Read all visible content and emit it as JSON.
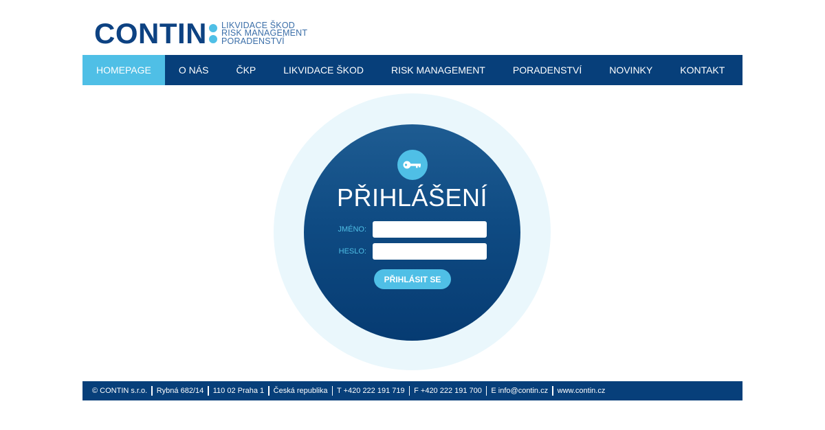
{
  "logo": {
    "word": "CONTIN",
    "tagline": [
      "LIKVIDACE ŠKOD",
      "RISK MANAGEMENT",
      "PORADENSTVÍ"
    ]
  },
  "nav": {
    "items": [
      {
        "label": "HOMEPAGE",
        "active": true
      },
      {
        "label": "O NÁS"
      },
      {
        "label": "ČKP"
      },
      {
        "label": "LIKVIDACE ŠKOD"
      },
      {
        "label": "RISK MANAGEMENT"
      },
      {
        "label": "PORADENSTVÍ"
      },
      {
        "label": "NOVINKY"
      },
      {
        "label": "KONTAKT"
      }
    ]
  },
  "login": {
    "icon": "key-icon",
    "title": "PŘIHLÁŠENÍ",
    "username_label": "JMÉNO:",
    "username_value": "",
    "password_label": "HESLO:",
    "password_value": "",
    "submit_label": "PŘIHLÁSIT SE"
  },
  "footer": {
    "items": [
      "© CONTIN s.r.o.",
      "Rybná 682/14",
      "110 02 Praha 1",
      "Česká republika",
      "T +420 222 191 719",
      "F +420 222 191 700",
      "E info@contin.cz",
      "www.contin.cz"
    ]
  },
  "colors": {
    "brand_dark": "#073f7a",
    "brand_light": "#4fbfe6",
    "circle_bg": "#eaf7fc"
  }
}
